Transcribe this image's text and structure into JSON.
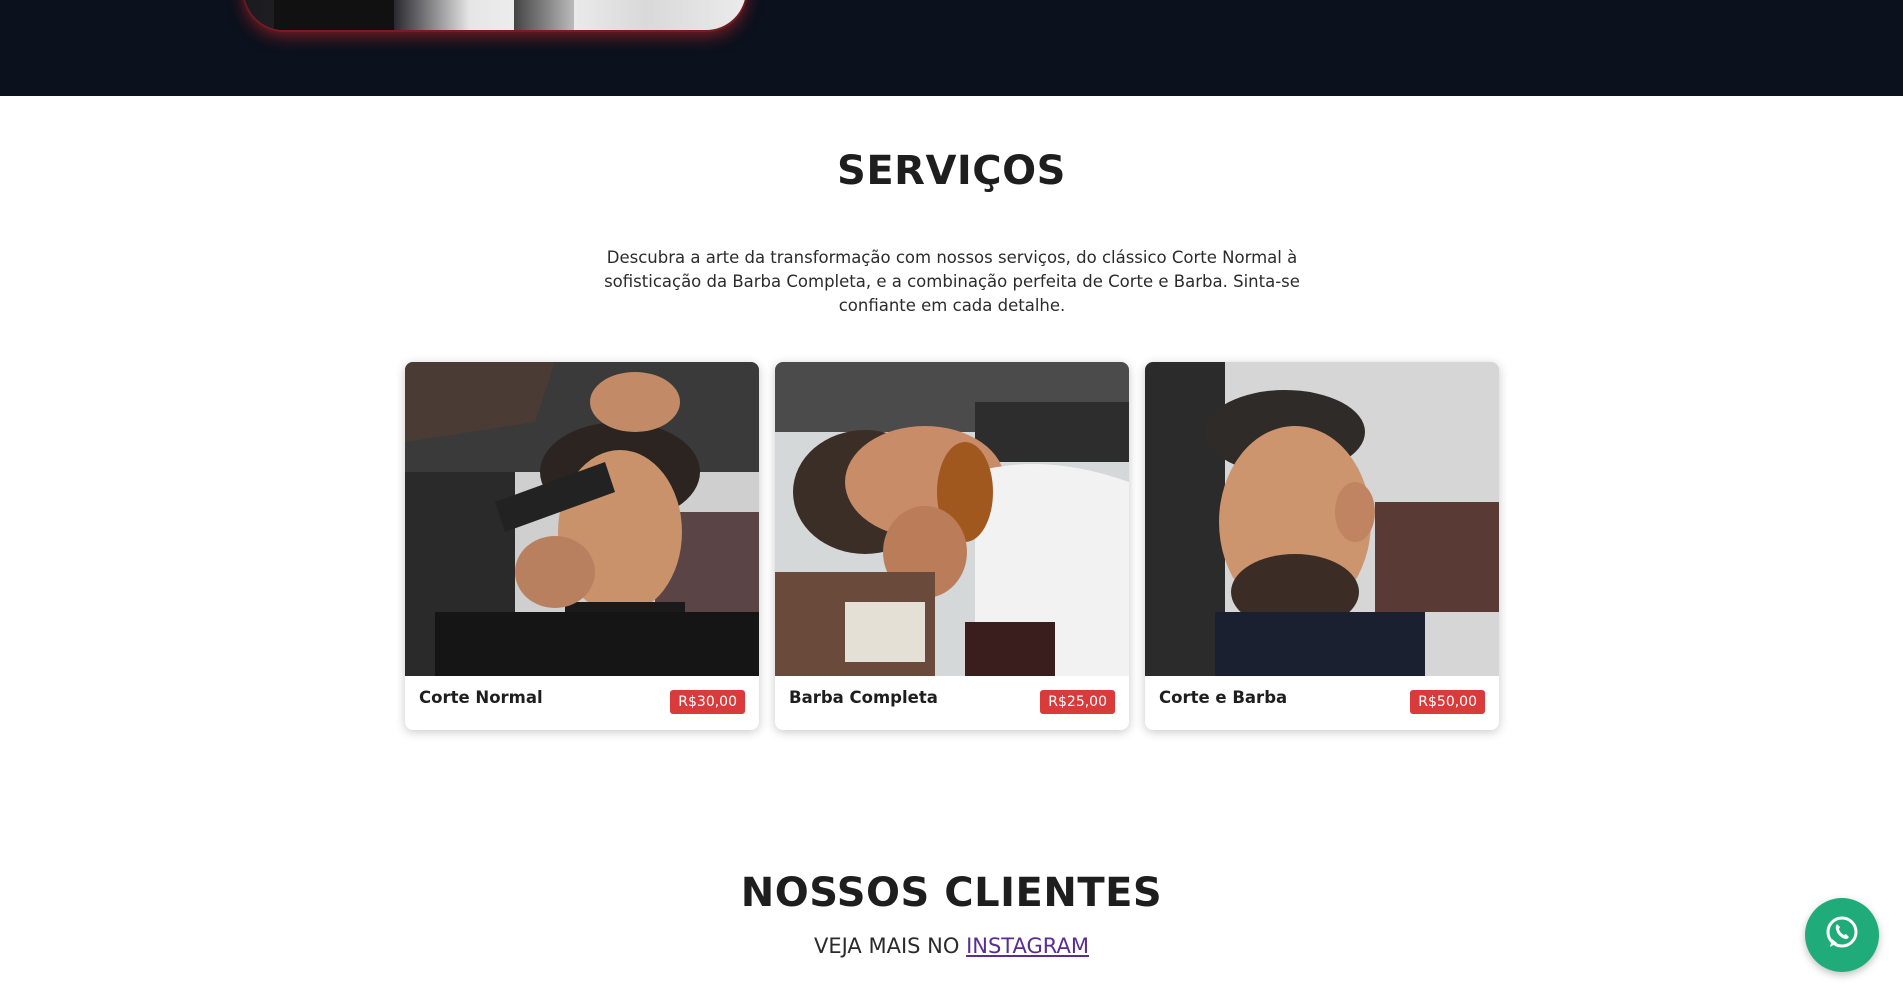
{
  "services": {
    "title": "SERVIÇOS",
    "description": "Descubra a arte da transformação com nossos serviços, do clássico Corte Normal à sofisticação da Barba Completa, e a combinação perfeita de Corte e Barba. Sinta-se confiante em cada detalhe.",
    "items": [
      {
        "name": "Corte Normal",
        "price": "R$30,00",
        "image": "haircut-photo"
      },
      {
        "name": "Barba Completa",
        "price": "R$25,00",
        "image": "beard-photo"
      },
      {
        "name": "Corte e Barba",
        "price": "R$50,00",
        "image": "haircut-beard-photo"
      }
    ]
  },
  "clients": {
    "title": "NOSSOS CLIENTES",
    "subtitle_prefix": "VEJA MAIS NO",
    "instagram_link": "INSTAGRAM"
  },
  "floating": {
    "whatsapp_icon": "whatsapp-icon"
  },
  "colors": {
    "hero_bg": "#0b111d",
    "price_badge": "#d93a3a",
    "whatsapp": "#1fab7a",
    "link": "#5a2d91"
  }
}
